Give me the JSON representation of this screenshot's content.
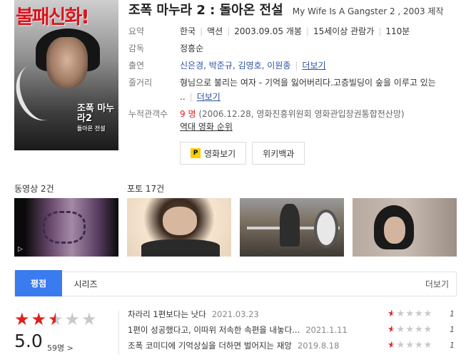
{
  "poster": {
    "headline": "불패신화!",
    "logo_title": "조폭 마누라2",
    "logo_sub": "돌아온 전설"
  },
  "movie": {
    "title_kr": "조폭 마누라 2 : 돌아온 전설",
    "title_en": "My Wife Is A Gangster 2 , 2003 제작"
  },
  "info": {
    "summary_label": "요약",
    "summary": [
      "한국",
      "액션",
      "2003.09.05 개봉",
      "15세이상 관람가",
      "110분"
    ],
    "director_label": "감독",
    "director": "정흥순",
    "cast_label": "출연",
    "cast": "신은경, 박준규, 김영호, 이원종",
    "cast_more": "더보기",
    "plot_label": "줄거리",
    "plot": "형님으로 불리는 여자 - 기억을 잃어버리다.고층빌딩이 숲을 이루고 있는 ..",
    "plot_more": "더보기",
    "audience_label": "누적관객수",
    "audience_count": "9 명",
    "audience_source": "(2006.12.28, 영화진흥위원회 영화관입장권통합전산망)",
    "box_office_link": "역대 영화 순위"
  },
  "buttons": {
    "watch": "영화보기",
    "wiki": "위키백과"
  },
  "videos": {
    "label": "동영상 2건"
  },
  "photos": {
    "label": "포토 17건"
  },
  "tabs": {
    "rating": "평점",
    "series": "시리즈",
    "more": "더보기"
  },
  "rating": {
    "score": "5.0",
    "votes": "59명 >",
    "stars_value": 2.5,
    "stars_max": 5
  },
  "reviews": [
    {
      "text": "차라리 1편보다는 낫다",
      "date": "2021.03.23",
      "rating": 1
    },
    {
      "text": "1편이 성공했다고, 이따위 저속한 속편을 내놓다...",
      "date": "2021.1.11",
      "rating": 1
    },
    {
      "text": "조폭 코미디에 기억상실을 더하면 벌어지는 재앙",
      "date": "2019.8.18",
      "rating": 1
    }
  ],
  "colors": {
    "accent": "#3a7bf0",
    "star_red": "#e0201c",
    "star_gray": "#c9c9c9",
    "link": "#2b51a3"
  }
}
